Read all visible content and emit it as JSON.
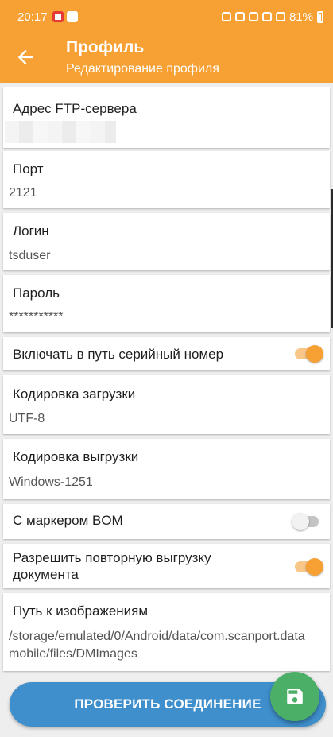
{
  "status_bar": {
    "time": "20:17",
    "battery": "81%"
  },
  "app_bar": {
    "title": "Профиль",
    "subtitle": "Редактирование профиля",
    "back_icon": "arrow-left-icon"
  },
  "fields": {
    "ftp_server": {
      "label": "Адрес FTP-сервера",
      "value": ""
    },
    "port": {
      "label": "Порт",
      "value": "2121"
    },
    "login": {
      "label": "Логин",
      "value": "tsduser"
    },
    "password": {
      "label": "Пароль",
      "value": "***********"
    },
    "serial_in_path": {
      "label": "Включать в путь серийный номер",
      "enabled": true
    },
    "upload_encoding": {
      "label": "Кодировка загрузки",
      "value": "UTF-8"
    },
    "download_encoding": {
      "label": "Кодировка выгрузки",
      "value": "Windows-1251"
    },
    "bom_marker": {
      "label": "С маркером BOM",
      "enabled": false
    },
    "repeat_upload": {
      "label": "Разрешить повторную выгрузку документа",
      "enabled": true
    },
    "images_path": {
      "label": "Путь к изображениям",
      "value": "/storage/emulated/0/Android/data/com.scanport.datamobile/files/DMImages"
    }
  },
  "actions": {
    "verify_label": "ПРОВЕРИТЬ СОЕДИНЕНИЕ",
    "save_icon": "floppy-disk-icon"
  },
  "colors": {
    "accent": "#f7a135",
    "button": "#3f8fcc",
    "fab": "#4caf68"
  }
}
